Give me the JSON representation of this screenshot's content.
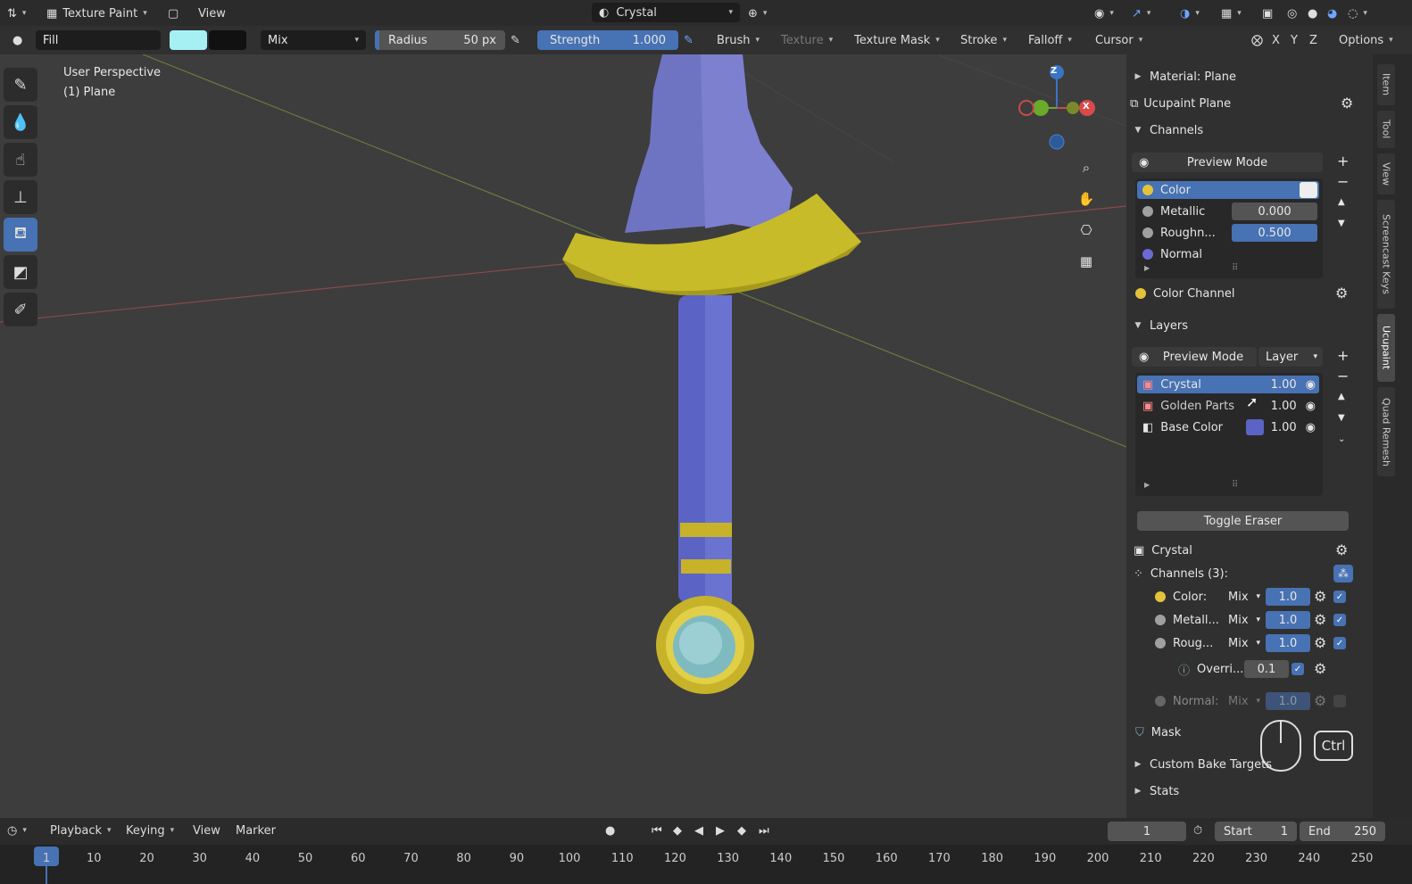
{
  "topbar": {
    "mode": "Texture Paint",
    "view": "View",
    "material": "Crystal"
  },
  "toolhdr": {
    "brush_name": "Fill",
    "blend": "Mix",
    "radius_label": "Radius",
    "radius_value": "50 px",
    "strength_label": "Strength",
    "strength_value": "1.000",
    "brush": "Brush",
    "texture": "Texture",
    "texture_mask": "Texture Mask",
    "stroke": "Stroke",
    "falloff": "Falloff",
    "cursor": "Cursor",
    "axis_x": "X",
    "axis_y": "Y",
    "axis_z": "Z",
    "options": "Options",
    "color_primary": "#a6f0f4",
    "color_secondary": "#111111"
  },
  "viewport": {
    "line1": "User Perspective",
    "line2": "(1) Plane",
    "gizmo_z": "Z",
    "gizmo_x": "X"
  },
  "panel": {
    "material": "Material: Plane",
    "ucupaint": "Ucupaint Plane",
    "channels_header": "Channels",
    "preview_mode": "Preview Mode",
    "channels": [
      {
        "name": "Color",
        "value": "",
        "color": "#e3c33a"
      },
      {
        "name": "Metallic",
        "value": "0.000",
        "color": "#a0a0a0"
      },
      {
        "name": "Roughn...",
        "value": "0.500",
        "color": "#a0a0a0"
      },
      {
        "name": "Normal",
        "value": "",
        "color": "#6b6bd6"
      }
    ],
    "color_channel": "Color Channel",
    "layers_header": "Layers",
    "layers_preview": "Preview Mode",
    "layers_mode": "Layer",
    "layers": [
      {
        "name": "Crystal",
        "value": "1.00"
      },
      {
        "name": "Golden Parts",
        "value": "1.00"
      },
      {
        "name": "Base Color",
        "value": "1.00"
      }
    ],
    "toggle_eraser": "Toggle Eraser",
    "active_layer": "Crystal",
    "layer_channels": "Channels (3):",
    "lchannels": [
      {
        "name": "Color:",
        "blend": "Mix",
        "value": "1.0"
      },
      {
        "name": "Metall...",
        "blend": "Mix",
        "value": "1.0"
      },
      {
        "name": "Roug...",
        "blend": "Mix",
        "value": "1.0"
      }
    ],
    "override_label": "Overri...",
    "override_value": "0.1",
    "normal_label": "Normal:",
    "normal_blend": "Mix",
    "normal_value": "1.0",
    "mask": "Mask",
    "custom_bake": "Custom Bake Targets",
    "stats": "Stats",
    "ctrl_key": "Ctrl"
  },
  "sidetabs": [
    "Item",
    "Tool",
    "View",
    "Screencast Keys",
    "Ucupaint",
    "Quad Remesh"
  ],
  "timeline": {
    "playback": "Playback",
    "keying": "Keying",
    "view": "View",
    "marker": "Marker",
    "current_frame": "1",
    "start_label": "Start",
    "start_value": "1",
    "end_label": "End",
    "end_value": "250",
    "ticks": [
      "1",
      "10",
      "20",
      "30",
      "40",
      "50",
      "60",
      "70",
      "80",
      "90",
      "100",
      "110",
      "120",
      "130",
      "140",
      "150",
      "160",
      "170",
      "180",
      "190",
      "200",
      "210",
      "220",
      "230",
      "240",
      "250"
    ]
  }
}
